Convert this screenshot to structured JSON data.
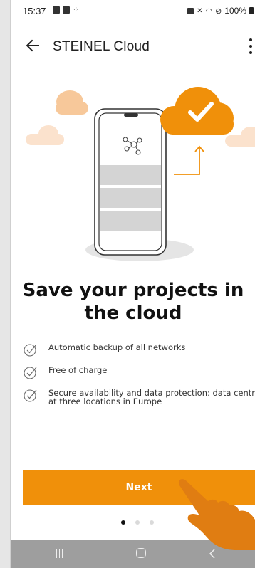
{
  "status_bar": {
    "time": "15:37",
    "battery": "100%"
  },
  "app_bar": {
    "title": "STEINEL Cloud",
    "back_icon": "arrow-left-icon",
    "menu_icon": "kebab-menu-icon"
  },
  "headline": "Save your projects in the cloud",
  "features": [
    {
      "icon": "circle-check-icon",
      "lines": [
        "Automatic backup of all networks"
      ]
    },
    {
      "icon": "circle-check-icon",
      "lines": [
        "Free of charge"
      ]
    },
    {
      "icon": "circle-check-icon",
      "lines": [
        "Secure availability and data protection: data centres",
        "at three locations in Europe"
      ]
    }
  ],
  "next_button": {
    "label": "Next"
  },
  "pager": {
    "pages": 3,
    "active": 0
  },
  "colors": {
    "accent": "#f0900a",
    "cloud_light": "#f7c89a",
    "nav_bar": "#9e9e9e"
  }
}
